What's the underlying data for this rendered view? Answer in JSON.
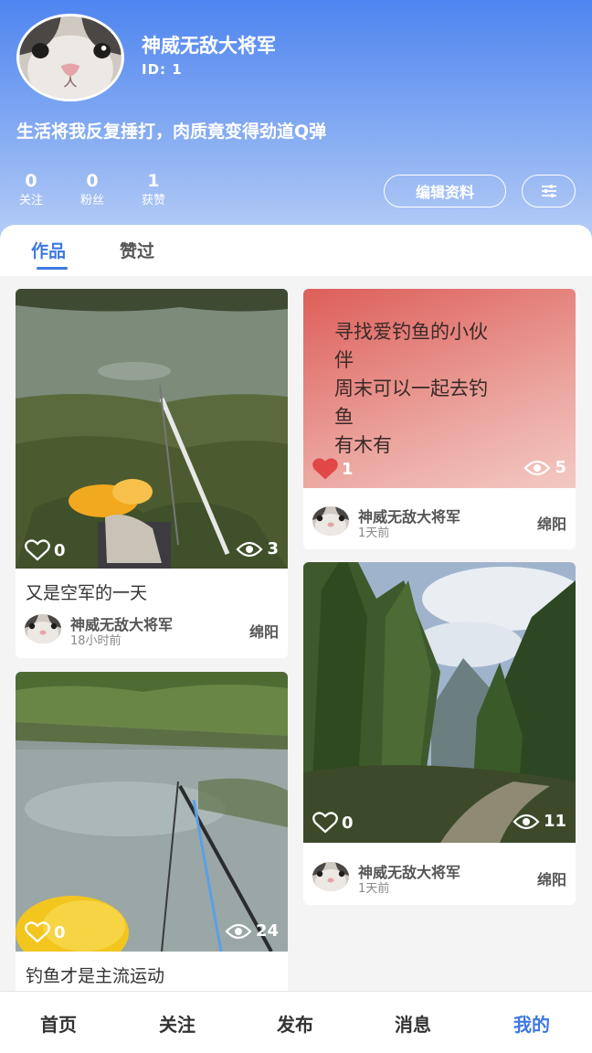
{
  "profile": {
    "nickname": "神威无敌大将军",
    "id_text": "ID: 1",
    "bio": "生活将我反复捶打，肉质竟变得劲道Q弹",
    "stats": [
      {
        "num": "0",
        "label": "关注"
      },
      {
        "num": "0",
        "label": "粉丝"
      },
      {
        "num": "1",
        "label": "获赞"
      }
    ],
    "edit_button": "编辑资料",
    "settings_icon": "sliders-icon",
    "avatar_icon": "cat-avatar"
  },
  "tabs": [
    {
      "label": "作品",
      "active": true
    },
    {
      "label": "赞过",
      "active": false
    }
  ],
  "posts": [
    {
      "cover": "photo-fishing-pond-grass",
      "title": "又是空军的一天",
      "likes": "0",
      "liked": false,
      "views": "3",
      "author": "神威无敌大将军",
      "time": "18小时前",
      "location": "绵阳"
    },
    {
      "cover": "text-cover",
      "cover_text": "寻找爱钓鱼的小伙\n伴\n周末可以一起去钓\n鱼\n有木有",
      "likes": "1",
      "liked": true,
      "views": "5",
      "author": "神威无敌大将军",
      "time": "1天前",
      "location": "绵阳"
    },
    {
      "cover": "photo-forest-mountain",
      "likes": "0",
      "liked": false,
      "views": "11",
      "author": "神威无敌大将军",
      "time": "1天前",
      "location": "绵阳"
    },
    {
      "cover": "photo-fishing-pond-rods",
      "title": "钓鱼才是主流运动",
      "likes": "0",
      "liked": false,
      "views": "24"
    }
  ],
  "nav": [
    {
      "label": "首页",
      "active": false
    },
    {
      "label": "关注",
      "active": false
    },
    {
      "label": "发布",
      "active": false
    },
    {
      "label": "消息",
      "active": false
    },
    {
      "label": "我的",
      "active": true
    }
  ],
  "colors": {
    "accent": "#3f78e0",
    "header_top": "#4f85f0",
    "like_red": "#e04848"
  }
}
